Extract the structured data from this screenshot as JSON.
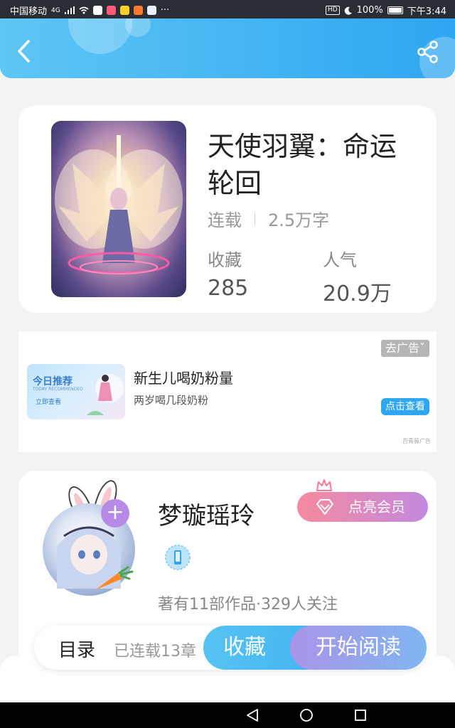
{
  "status_bar": {
    "carrier": "中国移动",
    "signal_tag": "4G",
    "overflow": "···",
    "hd": "HD",
    "battery": "100%",
    "time": "下午3:44"
  },
  "header": {
    "back_icon": "chevron-left-icon",
    "share_icon": "share-icon"
  },
  "book": {
    "title": "天使羽翼：命运轮回",
    "status": "连载",
    "word_count": "2.5万字",
    "collect_label": "收藏",
    "collect_value": "285",
    "popularity_label": "人气",
    "popularity_value": "20.9万"
  },
  "ad": {
    "close_label": "去广告ˇ",
    "image_title": "今日推荐",
    "image_subtitle": "TODAY RECOMMENDED",
    "image_button": "立即查看",
    "title": "新生儿喝奶粉量",
    "description": "两岁喝几段奶粉",
    "cta": "点击查看",
    "source": "百青藤广告"
  },
  "author": {
    "name": "梦璇瑶玲",
    "follow_icon": "plus-icon",
    "vip_label": "点亮会员",
    "stats": "著有11部作品·329人关注"
  },
  "bottom_bar": {
    "toc_label": "目录",
    "toc_status": "已连载13章",
    "collect_button": "收藏",
    "read_button": "开始阅读"
  },
  "colors": {
    "header_start": "#5ec6f4",
    "header_end": "#2fa6f2",
    "vip_start": "#f58a9e",
    "vip_end": "#c389e0",
    "read_start": "#a994e8",
    "read_end": "#7fb6f1"
  }
}
